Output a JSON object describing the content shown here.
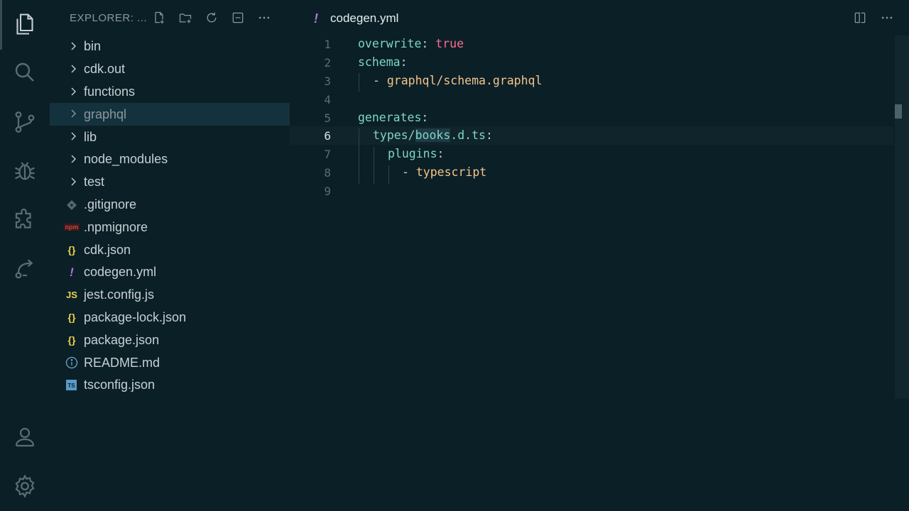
{
  "explorer": {
    "title": "EXPLORER: ...",
    "actions": [
      "new-file-icon",
      "new-folder-icon",
      "refresh-icon",
      "collapse-icon",
      "more-icon"
    ]
  },
  "tree": {
    "items": [
      {
        "label": "bin",
        "type": "folder"
      },
      {
        "label": "cdk.out",
        "type": "folder"
      },
      {
        "label": "functions",
        "type": "folder"
      },
      {
        "label": "graphql",
        "type": "folder",
        "selected": true
      },
      {
        "label": "lib",
        "type": "folder"
      },
      {
        "label": "node_modules",
        "type": "folder"
      },
      {
        "label": "test",
        "type": "folder"
      },
      {
        "label": ".gitignore",
        "type": "git"
      },
      {
        "label": ".npmignore",
        "type": "npm"
      },
      {
        "label": "cdk.json",
        "type": "json"
      },
      {
        "label": "codegen.yml",
        "type": "yml"
      },
      {
        "label": "jest.config.js",
        "type": "js"
      },
      {
        "label": "package-lock.json",
        "type": "json"
      },
      {
        "label": "package.json",
        "type": "json"
      },
      {
        "label": "README.md",
        "type": "info"
      },
      {
        "label": "tsconfig.json",
        "type": "ts"
      }
    ],
    "icons": {
      "json": "{}",
      "yml": "!",
      "js": "JS",
      "ts": "TS",
      "npm": "npm"
    }
  },
  "editor": {
    "tab_label": "codegen.yml",
    "tab_icon": "!",
    "current_line": 6,
    "lines": [
      {
        "n": "1",
        "key": "overwrite",
        "colon": ": ",
        "value": "true"
      },
      {
        "n": "2",
        "key": "schema",
        "colon": ":"
      },
      {
        "n": "3",
        "dash": "- ",
        "str": "graphql/schema.graphql"
      },
      {
        "n": "4"
      },
      {
        "n": "5",
        "key": "generates",
        "colon": ":"
      },
      {
        "n": "6",
        "key_a": "types/",
        "key_sel": "books",
        "key_b": ".d.ts",
        "colon": ":"
      },
      {
        "n": "7",
        "key": "plugins",
        "colon": ":"
      },
      {
        "n": "8",
        "dash": "- ",
        "str": "typescript"
      },
      {
        "n": "9"
      }
    ]
  },
  "colors": {
    "background": "#0b1f27",
    "key": "#7ed6c4",
    "bool": "#ff6b8b",
    "string": "#f4c38a",
    "yml_icon": "#b07cd8",
    "json_icon": "#e8d44d"
  }
}
